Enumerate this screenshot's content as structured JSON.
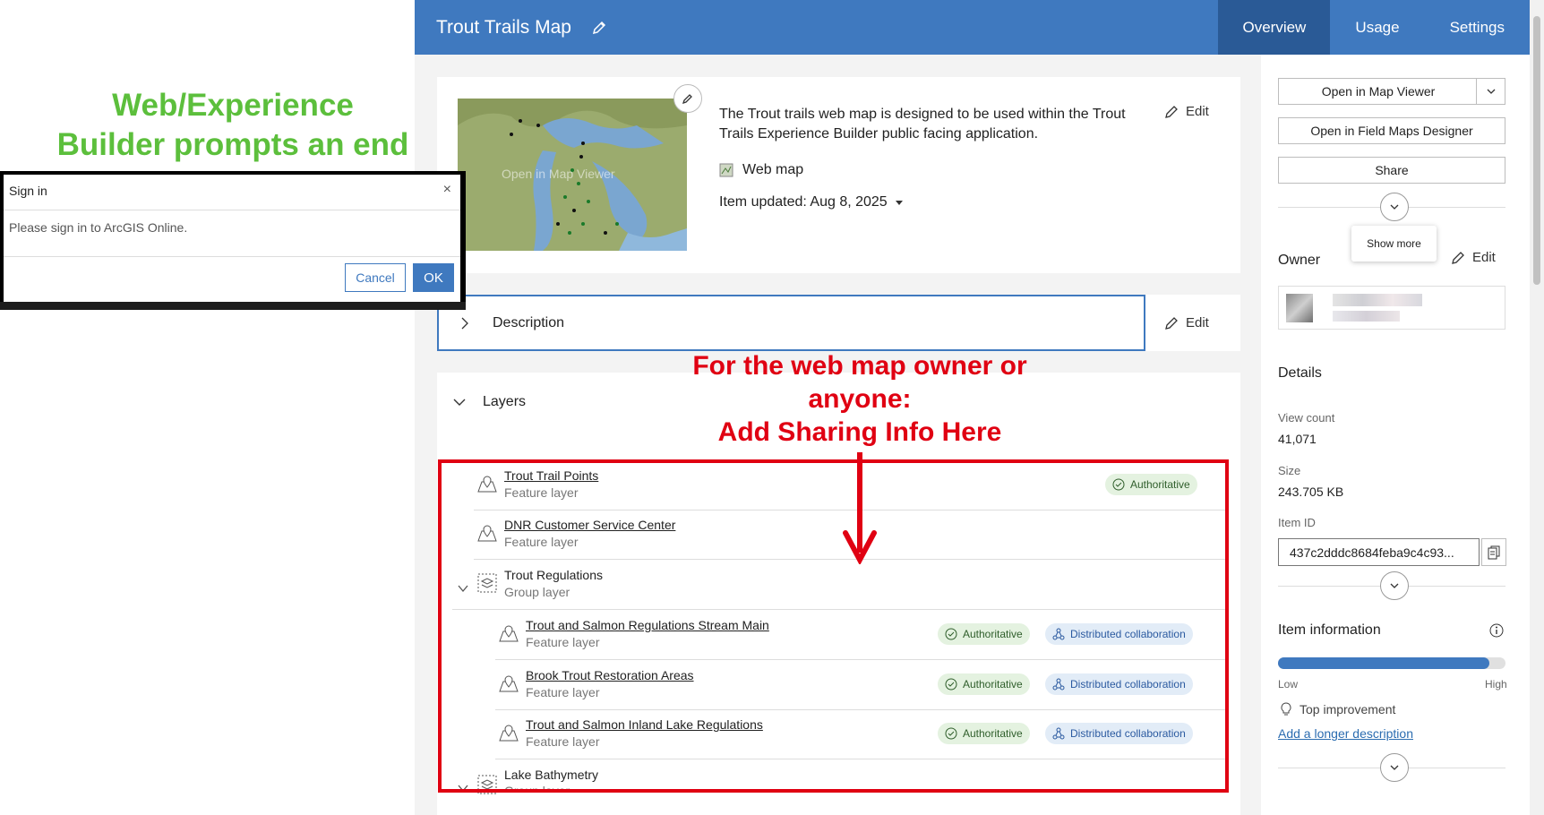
{
  "header": {
    "title": "Trout Trails Map",
    "tabs": [
      {
        "label": "Overview",
        "active": true
      },
      {
        "label": "Usage",
        "active": false
      },
      {
        "label": "Settings",
        "active": false
      }
    ],
    "color": "#3f79bf"
  },
  "thumbnail": {
    "overlay_text": "Open in Map Viewer"
  },
  "overview": {
    "summary": "The Trout trails web map is designed to be used within the Trout Trails Experience Builder public facing application.",
    "edit_label": "Edit",
    "item_type": "Web map",
    "updated": "Item updated: Aug 8, 2025"
  },
  "description": {
    "label": "Description",
    "edit_label": "Edit"
  },
  "layers": {
    "heading": "Layers",
    "items": [
      {
        "name": "Trout Trail Points",
        "type": "Feature layer",
        "authoritative": "Authoritative"
      },
      {
        "name": "DNR Customer Service Center",
        "type": "Feature layer"
      },
      {
        "name": "Trout Regulations",
        "type": "Group layer"
      },
      {
        "name": "Trout and Salmon Regulations Stream Main",
        "type": "Feature layer",
        "authoritative": "Authoritative",
        "collab": "Distributed collaboration"
      },
      {
        "name": "Brook Trout Restoration Areas",
        "type": "Feature layer",
        "authoritative": "Authoritative",
        "collab": "Distributed collaboration"
      },
      {
        "name": "Trout and Salmon Inland Lake Regulations",
        "type": "Feature layer",
        "authoritative": "Authoritative",
        "collab": "Distributed collaboration"
      },
      {
        "name": "Lake Bathymetry",
        "type": "Group layer"
      }
    ]
  },
  "annotations": {
    "green_text": "Web/Experience Builder prompts an end user",
    "red_line1": "For the web map owner or anyone:",
    "red_line2": "Add Sharing Info Here"
  },
  "dialog": {
    "title": "Sign in",
    "close": "×",
    "message": "Please sign in to ArcGIS Online.",
    "cancel": "Cancel",
    "ok": "OK"
  },
  "sidebar": {
    "open_map_viewer": "Open in Map Viewer",
    "open_field_maps": "Open in Field Maps Designer",
    "share": "Share",
    "show_more_tooltip": "Show more",
    "owner_heading": "Owner",
    "owner_edit": "Edit",
    "details_heading": "Details",
    "view_count_label": "View count",
    "view_count": "41,071",
    "size_label": "Size",
    "size": "243.705 KB",
    "item_id_label": "Item ID",
    "item_id": "437c2dddc8684feba9c4c93...",
    "item_info_heading": "Item information",
    "meter_low": "Low",
    "meter_high": "High",
    "meter_level": 0.93,
    "top_improvement": "Top improvement",
    "add_longer_description": "Add a longer description"
  }
}
